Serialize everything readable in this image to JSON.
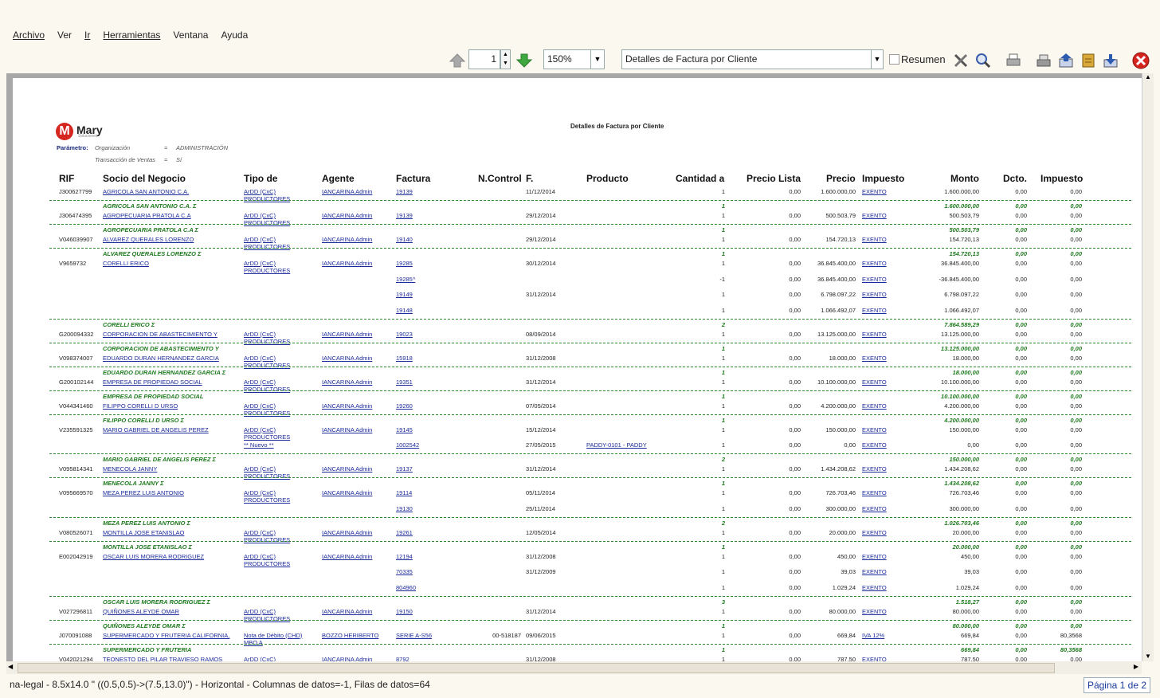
{
  "menu": {
    "items": [
      "Archivo",
      "Ver",
      "Ir",
      "Herramientas",
      "Ventana",
      "Ayuda"
    ]
  },
  "toolbar": {
    "page_value": "1",
    "zoom_value": "150%",
    "report_select": "Detalles de Factura por Cliente",
    "summary_label": "Resumen"
  },
  "report": {
    "logo_text": "Mary",
    "logo_sub": "Soluciones",
    "title": "Detalles de Factura por Cliente",
    "param_label": "Parámetro:",
    "params": [
      {
        "name": "Organización",
        "op": "=",
        "value": "ADMINISTRACIÓN"
      },
      {
        "name": "Transacción de Ventas",
        "op": "=",
        "value": "Sí"
      }
    ],
    "columns": [
      "RIF",
      "Socio del Negocio",
      "Tipo de",
      "Agente",
      "Factura",
      "N.Control",
      "F.",
      "Producto",
      "Cantidad a",
      "Precio Lista",
      "Precio",
      "Impuesto",
      "Monto",
      "Dcto.",
      "Impuesto"
    ],
    "rows": [
      {
        "rif": "J300627799",
        "socio": "AGRICOLA SAN ANTONIO C.A.",
        "tipo": "ArDD (CxC)",
        "tipo2": "PRODUCTORES",
        "agente": "IANCARINA Admin",
        "factura": "19139",
        "ncontrol": "",
        "fecha": "11/12/2014",
        "producto": "",
        "cant": "1",
        "plista": "0,00",
        "precio": "1.600.000,00",
        "imp": "EXENTO",
        "monto": "1.600.000,00",
        "dcto": "0,00",
        "imp2": "0,00"
      },
      {
        "group": "AGRICOLA SAN ANTONIO C.A. Σ",
        "gcant": "1",
        "gmonto": "1.600.000,00",
        "gdcto": "0,00",
        "gimp": "0,00"
      },
      {
        "rif": "J306474395",
        "socio": "AGROPECUARIA PRATOLA C.A",
        "tipo": "ArDD (CxC)",
        "tipo2": "PRODUCTORES",
        "agente": "IANCARINA Admin",
        "factura": "19139",
        "ncontrol": "",
        "fecha": "29/12/2014",
        "producto": "",
        "cant": "1",
        "plista": "0,00",
        "precio": "500.503,79",
        "imp": "EXENTO",
        "monto": "500.503,79",
        "dcto": "0,00",
        "imp2": "0,00"
      },
      {
        "group": "AGROPECUARIA PRATOLA C.A Σ",
        "gcant": "1",
        "gmonto": "500.503,79",
        "gdcto": "0,00",
        "gimp": "0,00"
      },
      {
        "rif": "V046039907",
        "socio": "ALVAREZ QUERALES LORENZO",
        "tipo": "ArDD (CxC)",
        "tipo2": "PRODUCTORES",
        "agente": "IANCARINA Admin",
        "factura": "19140",
        "ncontrol": "",
        "fecha": "29/12/2014",
        "producto": "",
        "cant": "1",
        "plista": "0,00",
        "precio": "154.720,13",
        "imp": "EXENTO",
        "monto": "154.720,13",
        "dcto": "0,00",
        "imp2": "0,00"
      },
      {
        "group": "ALVAREZ QUERALES LORENZO Σ",
        "gcant": "1",
        "gmonto": "154.720,13",
        "gdcto": "0,00",
        "gimp": "0,00"
      },
      {
        "rif": "V9659732",
        "socio": "CORELLI ERICO",
        "tipo": "ArDD (CxC)",
        "tipo2": "PRODUCTORES",
        "agente": "IANCARINA Admin",
        "factura": "19285",
        "ncontrol": "",
        "fecha": "30/12/2014",
        "producto": "",
        "cant": "1",
        "plista": "0,00",
        "precio": "36.845.400,00",
        "imp": "EXENTO",
        "monto": "36.845.400,00",
        "dcto": "0,00",
        "imp2": "0,00"
      },
      {
        "rif": "",
        "socio": "",
        "tipo": "",
        "tipo2": "",
        "agente": "",
        "factura": "19285^",
        "ncontrol": "",
        "fecha": "",
        "producto": "",
        "cant": "-1",
        "plista": "0,00",
        "precio": "36.845.400,00",
        "imp": "EXENTO",
        "monto": "-36.845.400,00",
        "dcto": "0,00",
        "imp2": "0,00"
      },
      {
        "rif": "",
        "socio": "",
        "tipo": "",
        "tipo2": "",
        "agente": "",
        "factura": "19149",
        "ncontrol": "",
        "fecha": "31/12/2014",
        "producto": "",
        "cant": "1",
        "plista": "0,00",
        "precio": "6.798.097,22",
        "imp": "EXENTO",
        "monto": "6.798.097,22",
        "dcto": "0,00",
        "imp2": "0,00"
      },
      {
        "rif": "",
        "socio": "",
        "tipo": "",
        "tipo2": "",
        "agente": "",
        "factura": "19148",
        "ncontrol": "",
        "fecha": "",
        "producto": "",
        "cant": "1",
        "plista": "0,00",
        "precio": "1.066.492,07",
        "imp": "EXENTO",
        "monto": "1.066.492,07",
        "dcto": "0,00",
        "imp2": "0,00"
      },
      {
        "group": "CORELLI ERICO Σ",
        "gcant": "2",
        "gmonto": "7.864.589,29",
        "gdcto": "0,00",
        "gimp": "0,00"
      },
      {
        "rif": "G200094332",
        "socio": "CORPORACION DE ABASTECIMIENTO Y",
        "tipo": "ArDD (CxC)",
        "tipo2": "PRODUCTORES",
        "agente": "IANCARINA Admin",
        "factura": "19023",
        "ncontrol": "",
        "fecha": "08/09/2014",
        "producto": "",
        "cant": "1",
        "plista": "0,00",
        "precio": "13.125.000,00",
        "imp": "EXENTO",
        "monto": "13.125.000,00",
        "dcto": "0,00",
        "imp2": "0,00"
      },
      {
        "group": "CORPORACION DE ABASTECIMIENTO Y",
        "gcant": "1",
        "gmonto": "13.125.000,00",
        "gdcto": "0,00",
        "gimp": "0,00"
      },
      {
        "rif": "V098374007",
        "socio": "EDUARDO DURAN HERNANDEZ GARCIA",
        "tipo": "ArDD (CxC)",
        "tipo2": "PRODUCTORES",
        "agente": "IANCARINA Admin",
        "factura": "15918",
        "ncontrol": "",
        "fecha": "31/12/2008",
        "producto": "",
        "cant": "1",
        "plista": "0,00",
        "precio": "18.000,00",
        "imp": "EXENTO",
        "monto": "18.000,00",
        "dcto": "0,00",
        "imp2": "0,00"
      },
      {
        "group": "EDUARDO DURAN HERNANDEZ GARCIA Σ",
        "gcant": "1",
        "gmonto": "18.000,00",
        "gdcto": "0,00",
        "gimp": "0,00"
      },
      {
        "rif": "G200102144",
        "socio": "EMPRESA DE PROPIEDAD SOCIAL",
        "tipo": "ArDD (CxC)",
        "tipo2": "PRODUCTORES",
        "agente": "IANCARINA Admin",
        "factura": "19351",
        "ncontrol": "",
        "fecha": "31/12/2014",
        "producto": "",
        "cant": "1",
        "plista": "0,00",
        "precio": "10.100.000,00",
        "imp": "EXENTO",
        "monto": "10.100.000,00",
        "dcto": "0,00",
        "imp2": "0,00"
      },
      {
        "group": "EMPRESA DE PROPIEDAD SOCIAL",
        "gcant": "1",
        "gmonto": "10.100.000,00",
        "gdcto": "0,00",
        "gimp": "0,00"
      },
      {
        "rif": "V044341460",
        "socio": "FILIPPO CORELLI D URSO",
        "tipo": "ArDD (CxC)",
        "tipo2": "PRODUCTORES",
        "agente": "IANCARINA Admin",
        "factura": "19260",
        "ncontrol": "",
        "fecha": "07/05/2014",
        "producto": "",
        "cant": "1",
        "plista": "0,00",
        "precio": "4.200.000,00",
        "imp": "EXENTO",
        "monto": "4.200.000,00",
        "dcto": "0,00",
        "imp2": "0,00"
      },
      {
        "group": "FILIPPO CORELLI D URSO Σ",
        "gcant": "1",
        "gmonto": "4.200.000,00",
        "gdcto": "0,00",
        "gimp": "0,00"
      },
      {
        "rif": "V235591325",
        "socio": "MARIO GABRIEL DE ANGELIS PEREZ",
        "tipo": "ArDD (CxC)",
        "tipo2": "PRODUCTORES",
        "agente": "IANCARINA Admin",
        "factura": "19145",
        "ncontrol": "",
        "fecha": "15/12/2014",
        "producto": "",
        "cant": "1",
        "plista": "0,00",
        "precio": "150.000,00",
        "imp": "EXENTO",
        "monto": "150.000,00",
        "dcto": "0,00",
        "imp2": "0,00"
      },
      {
        "rif": "",
        "socio": "",
        "tipo": "** Nuevo **",
        "tipo2": "",
        "agente": "",
        "factura": "1002542",
        "ncontrol": "",
        "fecha": "27/05/2015",
        "producto": "PADDY-0101 - PADDY",
        "cant": "1",
        "plista": "0,00",
        "precio": "0,00",
        "imp": "EXENTO",
        "monto": "0,00",
        "dcto": "0,00",
        "imp2": "0,00"
      },
      {
        "group": "MARIO GABRIEL DE ANGELIS PEREZ Σ",
        "gcant": "2",
        "gmonto": "150.000,00",
        "gdcto": "0,00",
        "gimp": "0,00"
      },
      {
        "rif": "V095814341",
        "socio": "MENECOLA JANNY",
        "tipo": "ArDD (CxC)",
        "tipo2": "PRODUCTORES",
        "agente": "IANCARINA Admin",
        "factura": "19137",
        "ncontrol": "",
        "fecha": "31/12/2014",
        "producto": "",
        "cant": "1",
        "plista": "0,00",
        "precio": "1.434.208,62",
        "imp": "EXENTO",
        "monto": "1.434.208,62",
        "dcto": "0,00",
        "imp2": "0,00"
      },
      {
        "group": "MENECOLA JANNY Σ",
        "gcant": "1",
        "gmonto": "1.434.208,62",
        "gdcto": "0,00",
        "gimp": "0,00"
      },
      {
        "rif": "V095669570",
        "socio": "MEZA PEREZ LUIS ANTONIO",
        "tipo": "ArDD (CxC)",
        "tipo2": "PRODUCTORES",
        "agente": "IANCARINA Admin",
        "factura": "19114",
        "ncontrol": "",
        "fecha": "05/11/2014",
        "producto": "",
        "cant": "1",
        "plista": "0,00",
        "precio": "726.703,46",
        "imp": "EXENTO",
        "monto": "726.703,46",
        "dcto": "0,00",
        "imp2": "0,00"
      },
      {
        "rif": "",
        "socio": "",
        "tipo": "",
        "tipo2": "",
        "agente": "",
        "factura": "19130",
        "ncontrol": "",
        "fecha": "25/11/2014",
        "producto": "",
        "cant": "1",
        "plista": "0,00",
        "precio": "300.000,00",
        "imp": "EXENTO",
        "monto": "300.000,00",
        "dcto": "0,00",
        "imp2": "0,00"
      },
      {
        "group": "MEZA PEREZ LUIS ANTONIO Σ",
        "gcant": "2",
        "gmonto": "1.026.703,46",
        "gdcto": "0,00",
        "gimp": "0,00"
      },
      {
        "rif": "V080526071",
        "socio": "MONTILLA JOSE ETANISLAO",
        "tipo": "ArDD (CxC)",
        "tipo2": "PRODUCTORES",
        "agente": "IANCARINA Admin",
        "factura": "19261",
        "ncontrol": "",
        "fecha": "12/05/2014",
        "producto": "",
        "cant": "1",
        "plista": "0,00",
        "precio": "20.000,00",
        "imp": "EXENTO",
        "monto": "20.000,00",
        "dcto": "0,00",
        "imp2": "0,00"
      },
      {
        "group": "MONTILLA JOSE ETANISLAO Σ",
        "gcant": "1",
        "gmonto": "20.000,00",
        "gdcto": "0,00",
        "gimp": "0,00"
      },
      {
        "rif": "E002042919",
        "socio": "OSCAR LUIS MORERA RODRIGUEZ",
        "tipo": "ArDD (CxC)",
        "tipo2": "PRODUCTORES",
        "agente": "IANCARINA Admin",
        "factura": "12194",
        "ncontrol": "",
        "fecha": "31/12/2008",
        "producto": "",
        "cant": "1",
        "plista": "0,00",
        "precio": "450,00",
        "imp": "EXENTO",
        "monto": "450,00",
        "dcto": "0,00",
        "imp2": "0,00"
      },
      {
        "rif": "",
        "socio": "",
        "tipo": "",
        "tipo2": "",
        "agente": "",
        "factura": "70335",
        "ncontrol": "",
        "fecha": "31/12/2009",
        "producto": "",
        "cant": "1",
        "plista": "0,00",
        "precio": "39,03",
        "imp": "EXENTO",
        "monto": "39,03",
        "dcto": "0,00",
        "imp2": "0,00"
      },
      {
        "rif": "",
        "socio": "",
        "tipo": "",
        "tipo2": "",
        "agente": "",
        "factura": "804960",
        "ncontrol": "",
        "fecha": "",
        "producto": "",
        "cant": "1",
        "plista": "0,00",
        "precio": "1.029,24",
        "imp": "EXENTO",
        "monto": "1.029,24",
        "dcto": "0,00",
        "imp2": "0,00"
      },
      {
        "group": "OSCAR LUIS MORERA RODRIGUEZ Σ",
        "gcant": "3",
        "gmonto": "1.518,27",
        "gdcto": "0,00",
        "gimp": "0,00"
      },
      {
        "rif": "V027296811",
        "socio": "QUIÑONES ALEYDE OMAR",
        "tipo": "ArDD (CxC)",
        "tipo2": "PRODUCTORES",
        "agente": "IANCARINA Admin",
        "factura": "19150",
        "ncontrol": "",
        "fecha": "31/12/2014",
        "producto": "",
        "cant": "1",
        "plista": "0,00",
        "precio": "80.000,00",
        "imp": "EXENTO",
        "monto": "80.000,00",
        "dcto": "0,00",
        "imp2": "0,00"
      },
      {
        "group": "QUIÑONES ALEYDE OMAR Σ",
        "gcant": "1",
        "gmonto": "80.000,00",
        "gdcto": "0,00",
        "gimp": "0,00"
      },
      {
        "rif": "J070091088",
        "socio": "SUPERMERCADO Y FRUTERIA CALIFORNIA,",
        "tipo": "Nota de Débito (CHD)",
        "tipo2": "MBO A",
        "agente": "BOZZO HERIBERTO",
        "factura": "SERIE A-S56",
        "ncontrol": "00-518187",
        "fecha": "09/06/2015",
        "producto": "",
        "cant": "1",
        "plista": "0,00",
        "precio": "669,84",
        "imp": "IVA 12%",
        "monto": "669,84",
        "dcto": "0,00",
        "imp2": "80,3568"
      },
      {
        "group": "SUPERMERCADO Y FRUTERIA",
        "gcant": "1",
        "gmonto": "669,84",
        "gdcto": "0,00",
        "gimp": "80,3568"
      },
      {
        "rif": "V042021294",
        "socio": "TEONESTO DEL PILAR TRAVIESO RAMOS",
        "tipo": "ArDD (CxC)",
        "tipo2": "PRODUCTORES",
        "agente": "IANCARINA Admin",
        "factura": "8792",
        "ncontrol": "",
        "fecha": "31/12/2008",
        "producto": "",
        "cant": "1",
        "plista": "0,00",
        "precio": "787,50",
        "imp": "EXENTO",
        "monto": "787,50",
        "dcto": "0,00",
        "imp2": "0,00"
      }
    ]
  },
  "status": {
    "text": "na-legal - 8.5x14.0 \" ((0.5,0.5)->(7.5,13.0)\") - Horizontal - Columnas de datos=-1, Filas de datos=64",
    "page": "Página 1 de 2"
  }
}
